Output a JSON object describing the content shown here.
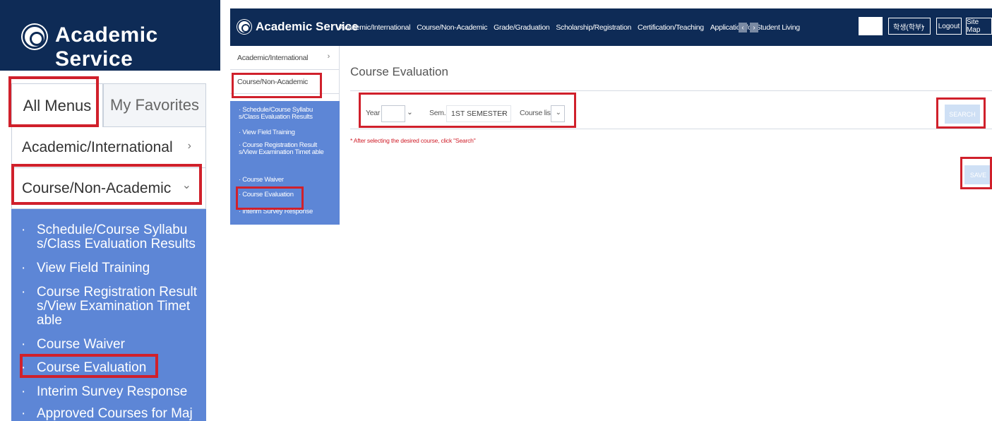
{
  "brand": {
    "title": "Academic Service"
  },
  "left_panel": {
    "tabs": {
      "all": "All Menus",
      "favorites": "My Favorites"
    },
    "menu": [
      {
        "label": "Academic/International",
        "chevron": "›"
      },
      {
        "label": "Course/Non-Academic",
        "chevron": "⌄"
      }
    ],
    "submenu": [
      "Schedule/Course Syllabu s/Class Evaluation Results",
      "View Field Training",
      "Course Registration Result s/View Examination Timet able",
      "Course Waiver",
      "Course Evaluation",
      "Interim Survey Response",
      "Approved Courses for Maj"
    ],
    "bullet": "·"
  },
  "topnav": {
    "items": [
      "Academic/International",
      "Course/Non-Academic",
      "Grade/Graduation",
      "Scholarship/Registration",
      "Certification/Teaching",
      "Application for Student Living"
    ],
    "prev_icon": "‹",
    "next_icon": "›",
    "role": "학생(학부)",
    "role_chevron": "⌄",
    "logout": "Logout",
    "sitemap": "Site Map"
  },
  "sidebar": {
    "items": [
      {
        "label": "Academic/International",
        "chevron": "›"
      },
      {
        "label": "Course/Non-Academic",
        "chevron": ""
      }
    ],
    "submenu": [
      "· Schedule/Course Syllabu s/Class Evaluation Results",
      "· View Field Training",
      "· Course Registration Result s/View Examination Timet able",
      "· Course Waiver",
      "· Course Evaluation",
      "· Interim Survey Response"
    ]
  },
  "main": {
    "title": "Course Evaluation",
    "filter": {
      "year_label": "Year",
      "year_value": "",
      "sem_label": "Sem.",
      "sem_value": "1ST SEMESTER",
      "course_label": "Course list",
      "course_value": "",
      "chevron": "⌄"
    },
    "search": "SEARCH",
    "note": "* After selecting the desired course, click \"Search\"",
    "save": "SAVE"
  },
  "colors": {
    "navy": "#0e2b56",
    "submenu_blue": "#5d86d6",
    "highlight_red": "#d0202b",
    "button_disabled": "#cfe0f5"
  }
}
